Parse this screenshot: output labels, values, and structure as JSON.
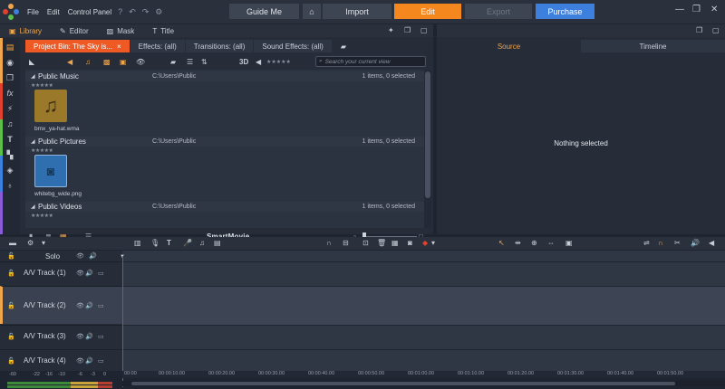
{
  "menu": {
    "items": [
      "File",
      "Edit",
      "Control Panel"
    ]
  },
  "modes": {
    "guide_me": "Guide Me",
    "import": "Import",
    "edit": "Edit",
    "export": "Export",
    "purchase": "Purchase"
  },
  "library": {
    "tabs": [
      "Library",
      "Editor",
      "Mask",
      "Title"
    ],
    "bin_tabs": [
      "Project Bin: The Sky is...",
      "Effects: (all)",
      "Transitions: (all)",
      "Sound Effects: (all)"
    ],
    "view_3d": "3D",
    "rating": "★★★★★",
    "search_placeholder": "Search your current view",
    "groups": [
      {
        "name": "Public Music",
        "path": "C:\\Users\\Public",
        "count": "1 items, 0 selected",
        "item": "bmx_ya-hat.wma",
        "rating": "★★★★★"
      },
      {
        "name": "Public Pictures",
        "path": "C:\\Users\\Public",
        "count": "1 items, 0 selected",
        "item": "whitebg_wide.png",
        "rating": "★★★★★"
      },
      {
        "name": "Public Videos",
        "path": "C:\\Users\\Public",
        "count": "1 items, 0 selected",
        "rating": "★★★★★"
      }
    ],
    "smartmovie": "SmartMovie"
  },
  "preview": {
    "tabs": [
      "Source",
      "Timeline"
    ],
    "empty": "Nothing selected"
  },
  "timeline": {
    "solo": "Solo",
    "tracks": [
      "A/V Track (1)",
      "A/V Track (2)",
      "A/V Track (3)",
      "A/V Track (4)"
    ],
    "ruler": [
      "00:00",
      "00:00:10.00",
      "00:00:20.00",
      "00:00:30.00",
      "00:00:40.00",
      "00:00:50.00",
      "00:01:00.00",
      "00:01:10.00",
      "00:01:20.00",
      "00:01:30.00",
      "00:01:40.00",
      "00:01:50.00"
    ],
    "meter_scale": [
      "-60",
      "-22",
      "-16",
      "-10",
      "-6",
      "-3",
      "0"
    ]
  },
  "colors": {
    "accent_orange": "#f0a64c",
    "edit_orange": "#f5871f",
    "bin_tab_orange": "#ef5a24",
    "purchase_blue": "#3d7fdc",
    "playhead_red": "#d6382b"
  }
}
